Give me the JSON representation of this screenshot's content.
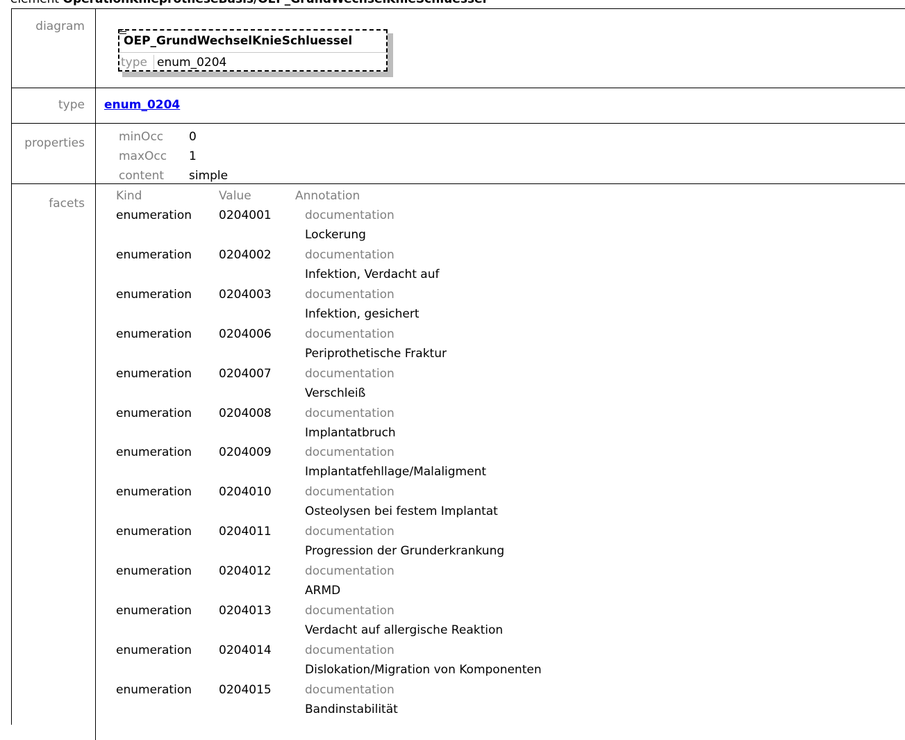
{
  "heading": {
    "prefix": "element ",
    "path": "OperationKnieprotheseBasis/OEP_GrundWechselKnieSchluessel"
  },
  "diagram": {
    "label": "diagram",
    "element_name": "OEP_GrundWechselKnieSchluessel",
    "type_label": "type",
    "type_value": "enum_0204"
  },
  "type_row": {
    "label": "type",
    "link_text": "enum_0204"
  },
  "properties": {
    "label": "properties",
    "items": [
      {
        "key": "minOcc",
        "value": "0"
      },
      {
        "key": "maxOcc",
        "value": "1"
      },
      {
        "key": "content",
        "value": "simple"
      }
    ]
  },
  "facets": {
    "label": "facets",
    "headers": {
      "kind": "Kind",
      "value": "Value",
      "annotation": "Annotation"
    },
    "rows": [
      {
        "kind": "enumeration",
        "value": "0204001",
        "doc_label": "documentation",
        "doc": "Lockerung"
      },
      {
        "kind": "enumeration",
        "value": "0204002",
        "doc_label": "documentation",
        "doc": "Infektion, Verdacht auf"
      },
      {
        "kind": "enumeration",
        "value": "0204003",
        "doc_label": "documentation",
        "doc": "Infektion, gesichert"
      },
      {
        "kind": "enumeration",
        "value": "0204006",
        "doc_label": "documentation",
        "doc": "Periprothetische Fraktur"
      },
      {
        "kind": "enumeration",
        "value": "0204007",
        "doc_label": "documentation",
        "doc": "Verschleiß"
      },
      {
        "kind": "enumeration",
        "value": "0204008",
        "doc_label": "documentation",
        "doc": "Implantatbruch"
      },
      {
        "kind": "enumeration",
        "value": "0204009",
        "doc_label": "documentation",
        "doc": "Implantatfehllage/Malaligment"
      },
      {
        "kind": "enumeration",
        "value": "0204010",
        "doc_label": "documentation",
        "doc": "Osteolysen bei festem Implantat"
      },
      {
        "kind": "enumeration",
        "value": "0204011",
        "doc_label": "documentation",
        "doc": "Progression der Grunderkrankung"
      },
      {
        "kind": "enumeration",
        "value": "0204012",
        "doc_label": "documentation",
        "doc": "ARMD"
      },
      {
        "kind": "enumeration",
        "value": "0204013",
        "doc_label": "documentation",
        "doc": "Verdacht auf allergische Reaktion"
      },
      {
        "kind": "enumeration",
        "value": "0204014",
        "doc_label": "documentation",
        "doc": "Dislokation/Migration von Komponenten"
      },
      {
        "kind": "enumeration",
        "value": "0204015",
        "doc_label": "documentation",
        "doc": "Bandinstabilität"
      }
    ]
  }
}
